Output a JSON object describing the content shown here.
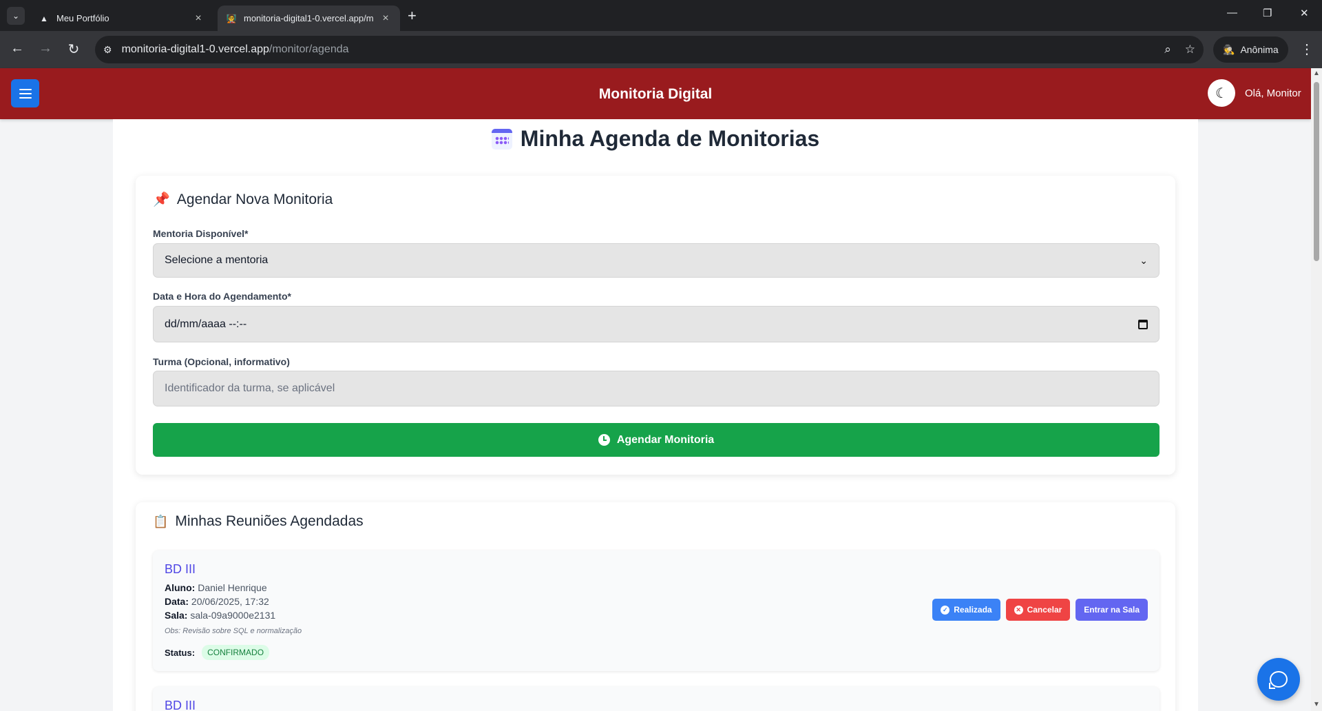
{
  "browser": {
    "tabs": [
      {
        "title": "Meu Portfólio",
        "favicon": "triangle-icon"
      },
      {
        "title": "monitoria-digital1-0.vercel.app/m",
        "favicon": "app-icon"
      }
    ],
    "url_host": "monitoria-digital1-0.vercel.app",
    "url_path": "/monitor/agenda",
    "incognito_label": "Anônima"
  },
  "header": {
    "title": "Monitoria Digital",
    "greeting": "Olá, Monitor",
    "color": "#991b1e"
  },
  "page": {
    "title": "Minha Agenda de Monitorias"
  },
  "form": {
    "heading": "Agendar Nova Monitoria",
    "mentoria_label": "Mentoria Disponível*",
    "mentoria_value": "Selecione a mentoria",
    "data_label": "Data e Hora do Agendamento*",
    "data_value": "dd/mm/aaaa --:--",
    "turma_label": "Turma (Opcional, informativo)",
    "turma_placeholder": "Identificador da turma, se aplicável",
    "submit_label": "Agendar Monitoria"
  },
  "meetings": {
    "heading": "Minhas Reuniões Agendadas",
    "items": [
      {
        "title": "BD III",
        "aluno_label": "Aluno:",
        "aluno": "Daniel Henrique",
        "data_label": "Data:",
        "data": "20/06/2025, 17:32",
        "sala_label": "Sala:",
        "sala": "sala-09a9000e2131",
        "obs": "Obs: Revisão sobre SQL e normalização",
        "status_label": "Status:",
        "status": "CONFIRMADO",
        "actions": {
          "done": "Realizada",
          "cancel": "Cancelar",
          "enter": "Entrar na Sala"
        }
      },
      {
        "title": "BD III"
      }
    ]
  }
}
